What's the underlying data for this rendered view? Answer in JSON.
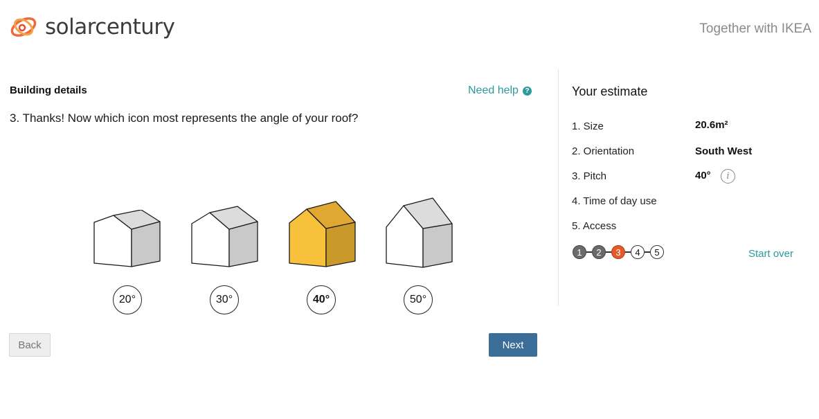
{
  "header": {
    "logo_text": "solarcentury",
    "partner_text": "Together with IKEA"
  },
  "main": {
    "section_title": "Building details",
    "help_label": "Need help",
    "help_icon": "?",
    "question": "3. Thanks! Now which icon most represents the angle of your roof?",
    "options": [
      {
        "label": "20°",
        "selected": false
      },
      {
        "label": "30°",
        "selected": false
      },
      {
        "label": "40°",
        "selected": true
      },
      {
        "label": "50°",
        "selected": false
      }
    ],
    "back_label": "Back",
    "next_label": "Next"
  },
  "estimate": {
    "title": "Your estimate",
    "rows": [
      {
        "label": "1. Size",
        "value": "20.6m²"
      },
      {
        "label": "2. Orientation",
        "value": "South West"
      },
      {
        "label": "3. Pitch",
        "value": "40°"
      },
      {
        "label": "4. Time of day use",
        "value": ""
      },
      {
        "label": "5. Access",
        "value": ""
      }
    ],
    "info_icon": "i",
    "steps": [
      "1",
      "2",
      "3",
      "4",
      "5"
    ],
    "current_step": 3,
    "start_over_label": "Start over"
  },
  "colors": {
    "accent": "#2a9a9e",
    "next_button": "#3a6e98",
    "current_step": "#e65a2a",
    "selected_house": "#f8c13c"
  }
}
